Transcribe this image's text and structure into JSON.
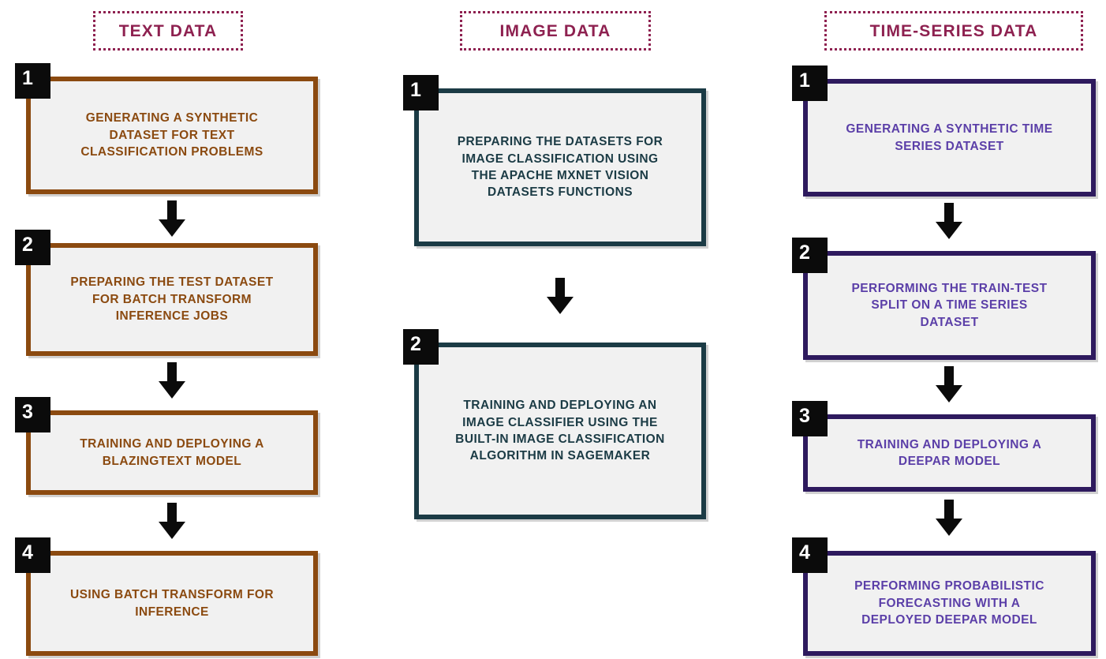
{
  "page": {
    "title": "Dataset Preparation Flowcharts",
    "background_color": "#FFFFFF"
  },
  "theme_colors": {
    "header_accent": "#8E2150",
    "text_data_border": "#8B4A10",
    "text_data_text": "#8B4A10",
    "image_data_border": "#1B3B45",
    "image_data_text": "#1B3B45",
    "timeseries_data_border": "#2E1A5E",
    "timeseries_data_text": "#5B3FA8",
    "box_fill": "#F1F1F1",
    "badge_fill": "#0B0B0B",
    "badge_text": "#FFFFFF",
    "arrow_fill": "#0B0B0B"
  },
  "columns": [
    {
      "id": "text-data",
      "header": "TEXT DATA",
      "steps": [
        {
          "number": "1",
          "label": "GENERATING A SYNTHETIC\nDATASET FOR TEXT\nCLASSIFICATION PROBLEMS"
        },
        {
          "number": "2",
          "label": "PREPARING THE TEST DATASET\nFOR BATCH TRANSFORM\nINFERENCE JOBS"
        },
        {
          "number": "3",
          "label": "TRAINING AND DEPLOYING A\nBLAZINGTEXT MODEL"
        },
        {
          "number": "4",
          "label": "USING BATCH TRANSFORM FOR\nINFERENCE"
        }
      ],
      "arrow_count": 3
    },
    {
      "id": "image-data",
      "header": "IMAGE DATA",
      "steps": [
        {
          "number": "1",
          "label": "PREPARING THE DATASETS FOR\nIMAGE CLASSIFICATION USING\nTHE APACHE MXNET VISION\nDATASETS FUNCTIONS"
        },
        {
          "number": "2",
          "label": "TRAINING AND DEPLOYING AN\nIMAGE CLASSIFIER USING THE\nBUILT-IN IMAGE CLASSIFICATION\nALGORITHM IN SAGEMAKER"
        }
      ],
      "arrow_count": 1
    },
    {
      "id": "timeseries-data",
      "header": "TIME-SERIES DATA",
      "steps": [
        {
          "number": "1",
          "label": "GENERATING A SYNTHETIC TIME\nSERIES DATASET"
        },
        {
          "number": "2",
          "label": "PERFORMING THE TRAIN-TEST\nSPLIT ON A TIME SERIES\nDATASET"
        },
        {
          "number": "3",
          "label": "TRAINING AND DEPLOYING A\nDEEPAR MODEL"
        },
        {
          "number": "4",
          "label": "PERFORMING PROBABILISTIC\nFORECASTING WITH A\nDEPLOYED DEEPAR MODEL"
        }
      ],
      "arrow_count": 3
    }
  ],
  "icons": {
    "arrow": "down-arrow-icon"
  }
}
